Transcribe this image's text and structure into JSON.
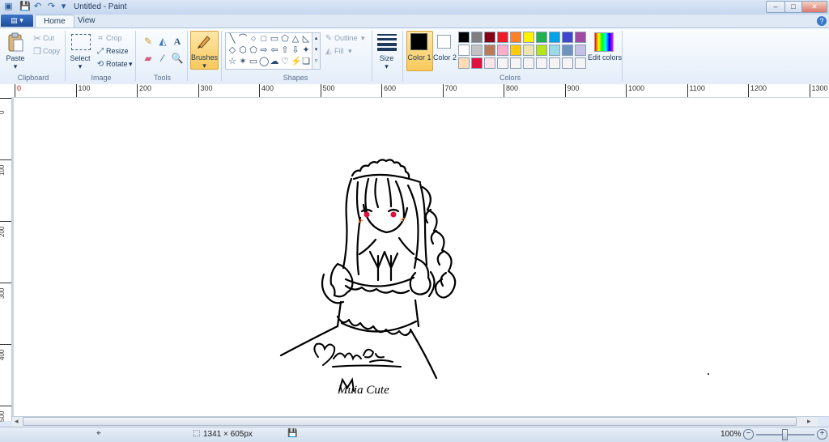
{
  "window": {
    "title": "Untitled - Paint",
    "controls": {
      "minimize": "‒",
      "maximize": "□",
      "close": "✕"
    }
  },
  "quick_access": [
    "save-icon",
    "undo-icon",
    "redo-icon",
    "customize-icon"
  ],
  "tabs": [
    {
      "label": "Home",
      "active": true
    },
    {
      "label": "View",
      "active": false
    }
  ],
  "ribbon": {
    "clipboard": {
      "group": "Clipboard",
      "paste": "Paste",
      "cut": "Cut",
      "copy": "Copy"
    },
    "image": {
      "group": "Image",
      "select": "Select",
      "crop": "Crop",
      "resize": "Resize",
      "rotate": "Rotate"
    },
    "tools": {
      "group": "Tools"
    },
    "brushes": {
      "label": "Brushes"
    },
    "shapes": {
      "group": "Shapes",
      "outline": "Outline",
      "fill": "Fill"
    },
    "size": {
      "label": "Size"
    },
    "colors": {
      "group": "Colors",
      "color1": "Color 1",
      "color2": "Color 2",
      "edit": "Edit colors",
      "color1_value": "#000000",
      "color2_value": "#ffffff",
      "palette_row1": [
        "#000000",
        "#7f7f7f",
        "#880015",
        "#ed1c24",
        "#ff7f27",
        "#fff200",
        "#22b14c",
        "#00a2e8",
        "#3f48cc",
        "#a349a4"
      ],
      "palette_row2": [
        "#ffffff",
        "#c3c3c3",
        "#b97a57",
        "#ffaec9",
        "#ffc90e",
        "#efe4b0",
        "#b5e61d",
        "#99d9ea",
        "#7092be",
        "#c8bfe7"
      ],
      "palette_row3": [
        "#ffdcb4",
        "#e0103c",
        "#ffe4ec",
        "#f4f4f4",
        "#f4f4f4",
        "#f4f4f4",
        "#f4f4f4",
        "#f4f4f4",
        "#f4f4f4",
        "#f4f4f4"
      ]
    }
  },
  "ruler": {
    "h_ticks": [
      "0",
      "100",
      "200",
      "300",
      "400",
      "500",
      "600",
      "700",
      "800",
      "900",
      "1000",
      "1100",
      "1200",
      "1300"
    ],
    "v_ticks": [
      "0",
      "100",
      "200",
      "300",
      "400",
      "500"
    ]
  },
  "canvas": {
    "signature_text": "Muia Cute"
  },
  "status": {
    "dimensions": "1341 × 605px",
    "zoom": "100%"
  }
}
